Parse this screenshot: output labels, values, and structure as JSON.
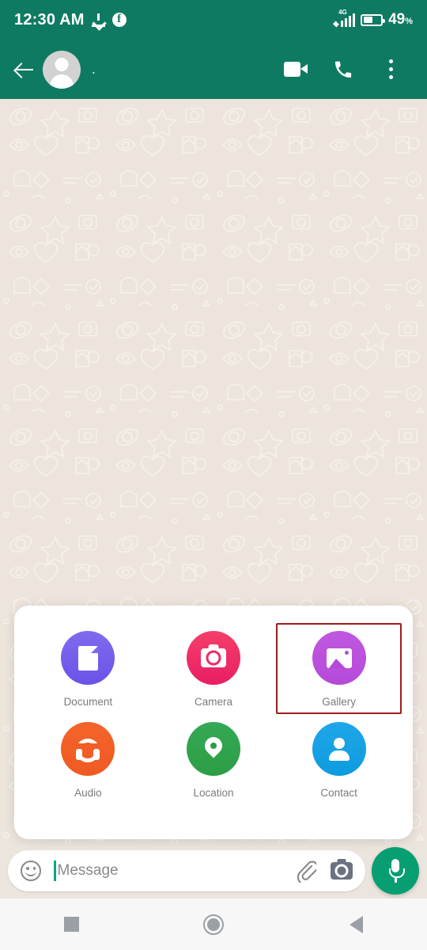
{
  "status_bar": {
    "time": "12:30 AM",
    "download_icon": "download-icon",
    "facebook_icon": "facebook-icon",
    "network_label": "4G",
    "signal_icon": "signal-bars-icon",
    "battery_icon": "battery-icon",
    "battery_percent": "49",
    "battery_percent_symbol": "%",
    "battery_level": 49
  },
  "header": {
    "back_icon": "back-arrow-icon",
    "avatar_icon": "avatar",
    "contact_name": ".",
    "video_call_icon": "video-call-icon",
    "voice_call_icon": "phone-call-icon",
    "overflow_icon": "more-options-icon",
    "background_color": "#0F7A62"
  },
  "chat": {
    "wallpaper_color": "#EDE5DC"
  },
  "attach_panel": {
    "selection_color": "#A01C1C",
    "selected_item": "Gallery",
    "rows": [
      [
        {
          "label": "Document",
          "icon": "document-icon",
          "color": "#7F6BEE",
          "color_end": "#6B52E8",
          "selected": false
        },
        {
          "label": "Camera",
          "icon": "camera-icon",
          "color": "#F43F6B",
          "color_end": "#E91E63",
          "selected": false
        },
        {
          "label": "Gallery",
          "icon": "gallery-icon",
          "color": "#C158E0",
          "color_end": "#B44AD8",
          "selected": true
        }
      ],
      [
        {
          "label": "Audio",
          "icon": "headphones-icon",
          "color": "#F4642A",
          "color_end": "#EF5A22",
          "selected": false
        },
        {
          "label": "Location",
          "icon": "location-pin-icon",
          "color": "#35A855",
          "color_end": "#2C9E45",
          "selected": false
        },
        {
          "label": "Contact",
          "icon": "contact-person-icon",
          "color": "#1EA7E8",
          "color_end": "#0E9BDF",
          "selected": false
        }
      ]
    ]
  },
  "input_bar": {
    "emoji_icon": "emoji-icon",
    "placeholder": "Message",
    "value": "",
    "attach_icon": "paperclip-icon",
    "camera_icon": "camera-icon",
    "mic_icon": "microphone-icon",
    "mic_button_color": "#079E72"
  },
  "nav_bar": {
    "recents_icon": "recents-square-icon",
    "home_icon": "home-circle-icon",
    "back_icon": "back-triangle-icon"
  }
}
